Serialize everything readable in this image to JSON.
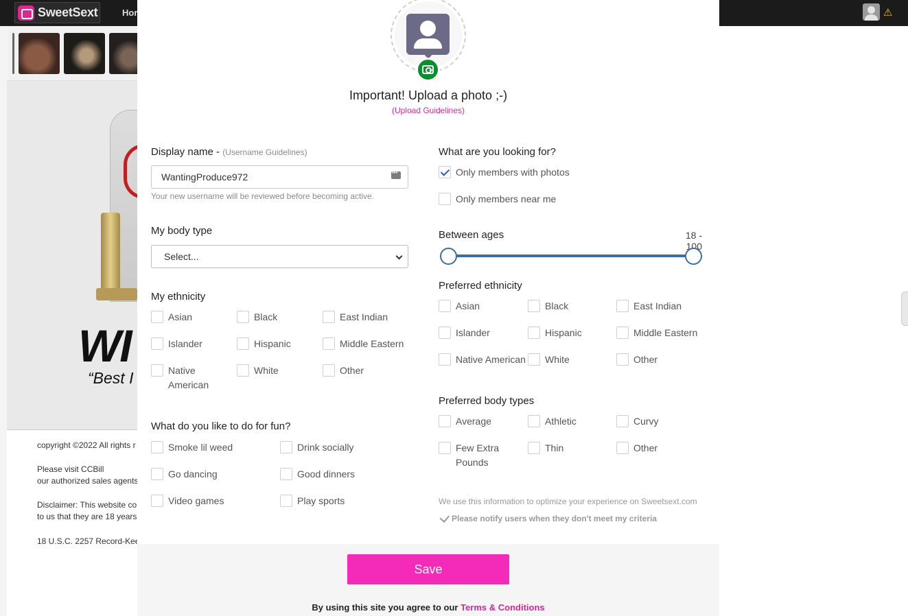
{
  "background": {
    "logo_text": "SweetSext",
    "nav_home": "Hor",
    "hero_big": "WI",
    "hero_quote": "“Best I",
    "footer": {
      "copyright": "copyright ©2022 All rights r",
      "visit_prefix": "Please visit ",
      "visit_link": "CCBill",
      "agents": "our authorized sales agents",
      "disclaimer": "Disclaimer: This website co",
      "disclaimer2": "to us that they are 18 years",
      "record": "18 U.S.C. 2257 Record-Kee"
    }
  },
  "modal": {
    "upload_title": "Important! Upload a photo ;-)",
    "upload_link": "(Upload Guidelines)",
    "display_name": {
      "label": "Display name - ",
      "guidelines": "(Username Guidelines)",
      "value": "WantingProduce972",
      "hint": "Your new username will be reviewed before becoming active."
    },
    "body_type": {
      "label": "My body type",
      "selected": "Select..."
    },
    "ethnicity": {
      "label": "My ethnicity",
      "options": [
        "Asian",
        "Black",
        "East Indian",
        "Islander",
        "Hispanic",
        "Middle Eastern",
        "Native American",
        "White",
        "Other"
      ]
    },
    "fun": {
      "label": "What do you like to do for fun?",
      "options": [
        "Smoke lil weed",
        "Drink socially",
        "Go dancing",
        "Good dinners",
        "Video games",
        "Play sports"
      ]
    },
    "looking_for": {
      "label": "What are you looking for?",
      "only_photos": "Only members with photos",
      "near_me": "Only members near me"
    },
    "ages": {
      "label": "Between ages",
      "range_text": "18 - 100",
      "min": 18,
      "max": 100
    },
    "pref_ethnicity": {
      "label": "Preferred ethnicity",
      "options": [
        "Asian",
        "Black",
        "East Indian",
        "Islander",
        "Hispanic",
        "Middle Eastern",
        "Native American",
        "White",
        "Other"
      ]
    },
    "pref_body": {
      "label": "Preferred body types",
      "options": [
        "Average",
        "Athletic",
        "Curvy",
        "Few Extra Pounds",
        "Thin",
        "Other"
      ]
    },
    "info_text": "We use this information to optimize your experience on Sweetsext.com",
    "notify_text": "Please notify users when they don't meet my criteria",
    "save_label": "Save",
    "terms_prefix": "By using this site you agree to our ",
    "terms_link": "Terms & Conditions"
  },
  "colors": {
    "accent_pink": "#f42bb8",
    "link_pink": "#e2229c",
    "slider_blue": "#3d6fa3",
    "camera_green": "#0a8f2e"
  }
}
